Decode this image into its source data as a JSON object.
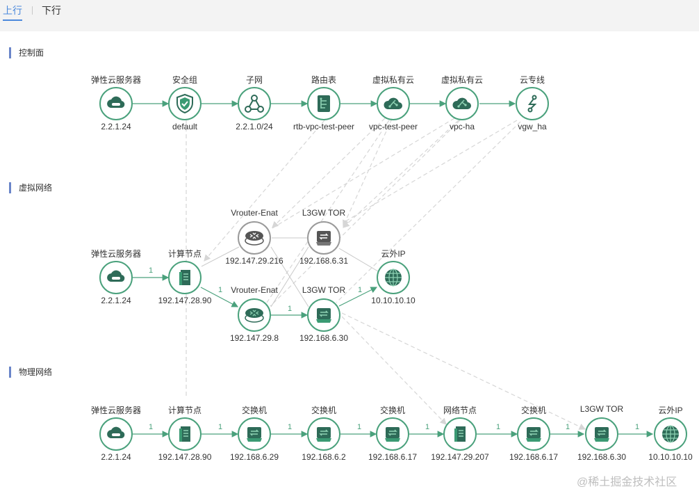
{
  "tabs": [
    {
      "label": "上行",
      "active": true
    },
    {
      "label": "下行",
      "active": false
    }
  ],
  "sections": {
    "control": "控制面",
    "virtual": "虚拟网络",
    "physical": "物理网络"
  },
  "colors": {
    "accent": "#4aa17c",
    "dashed_edge": "#cfcfcf",
    "tab_active": "#4b89dc",
    "section_marker": "#6a85c9"
  },
  "nodes": {
    "control": [
      {
        "id": "ecs",
        "title": "弹性云服务器",
        "sub": "2.2.1.24",
        "icon": "cloud-server-icon"
      },
      {
        "id": "sg",
        "title": "安全组",
        "sub": "default",
        "icon": "shield-check-icon"
      },
      {
        "id": "subnet",
        "title": "子网",
        "sub": "2.2.1.0/24",
        "icon": "subnet-icon"
      },
      {
        "id": "rtb",
        "title": "路由表",
        "sub": "rtb-vpc-test-peer",
        "icon": "route-table-icon"
      },
      {
        "id": "vpc1",
        "title": "虚拟私有云",
        "sub": "vpc-test-peer",
        "icon": "vpc-cloud-icon"
      },
      {
        "id": "vpc2",
        "title": "虚拟私有云",
        "sub": "vpc-ha",
        "icon": "vpc-cloud-icon"
      },
      {
        "id": "dc",
        "title": "云专线",
        "sub": "vgw_ha",
        "icon": "direct-connect-icon"
      }
    ],
    "virtual": [
      {
        "id": "v_ecs",
        "title": "弹性云服务器",
        "sub": "2.2.1.24",
        "icon": "cloud-server-icon"
      },
      {
        "id": "v_compute",
        "title": "计算节点",
        "sub": "192.147.28.90",
        "icon": "server-icon"
      },
      {
        "id": "v_router1",
        "title": "Vrouter-Enat",
        "sub": "192.147.29.216",
        "icon": "router-icon",
        "state": "inactive"
      },
      {
        "id": "v_router2",
        "title": "Vrouter-Enat",
        "sub": "192.147.29.8",
        "icon": "router-icon"
      },
      {
        "id": "v_tor1",
        "title": "L3GW TOR",
        "sub": "192.168.6.31",
        "icon": "switch-icon",
        "state": "inactive"
      },
      {
        "id": "v_tor2",
        "title": "L3GW TOR",
        "sub": "192.168.6.30",
        "icon": "switch-icon"
      },
      {
        "id": "v_ext",
        "title": "云外IP",
        "sub": "10.10.10.10",
        "icon": "globe-icon"
      }
    ],
    "physical": [
      {
        "id": "p_ecs",
        "title": "弹性云服务器",
        "sub": "2.2.1.24",
        "icon": "cloud-server-icon"
      },
      {
        "id": "p_compute",
        "title": "计算节点",
        "sub": "192.147.28.90",
        "icon": "server-icon"
      },
      {
        "id": "p_sw1",
        "title": "交换机",
        "sub": "192.168.6.29",
        "icon": "switch-icon"
      },
      {
        "id": "p_sw2",
        "title": "交换机",
        "sub": "192.168.6.2",
        "icon": "switch-icon"
      },
      {
        "id": "p_sw3",
        "title": "交换机",
        "sub": "192.168.6.17",
        "icon": "switch-icon"
      },
      {
        "id": "p_netnode",
        "title": "网络节点",
        "sub": "192.147.29.207",
        "icon": "server-icon"
      },
      {
        "id": "p_sw4",
        "title": "交换机",
        "sub": "192.168.6.17",
        "icon": "switch-icon"
      },
      {
        "id": "p_tor",
        "title": "L3GW TOR",
        "sub": "192.168.6.30",
        "icon": "switch-icon"
      },
      {
        "id": "p_ext",
        "title": "云外IP",
        "sub": "10.10.10.10",
        "icon": "globe-icon"
      }
    ]
  },
  "edge_labels": {
    "one": "1"
  },
  "watermark": "@稀土掘金技术社区"
}
